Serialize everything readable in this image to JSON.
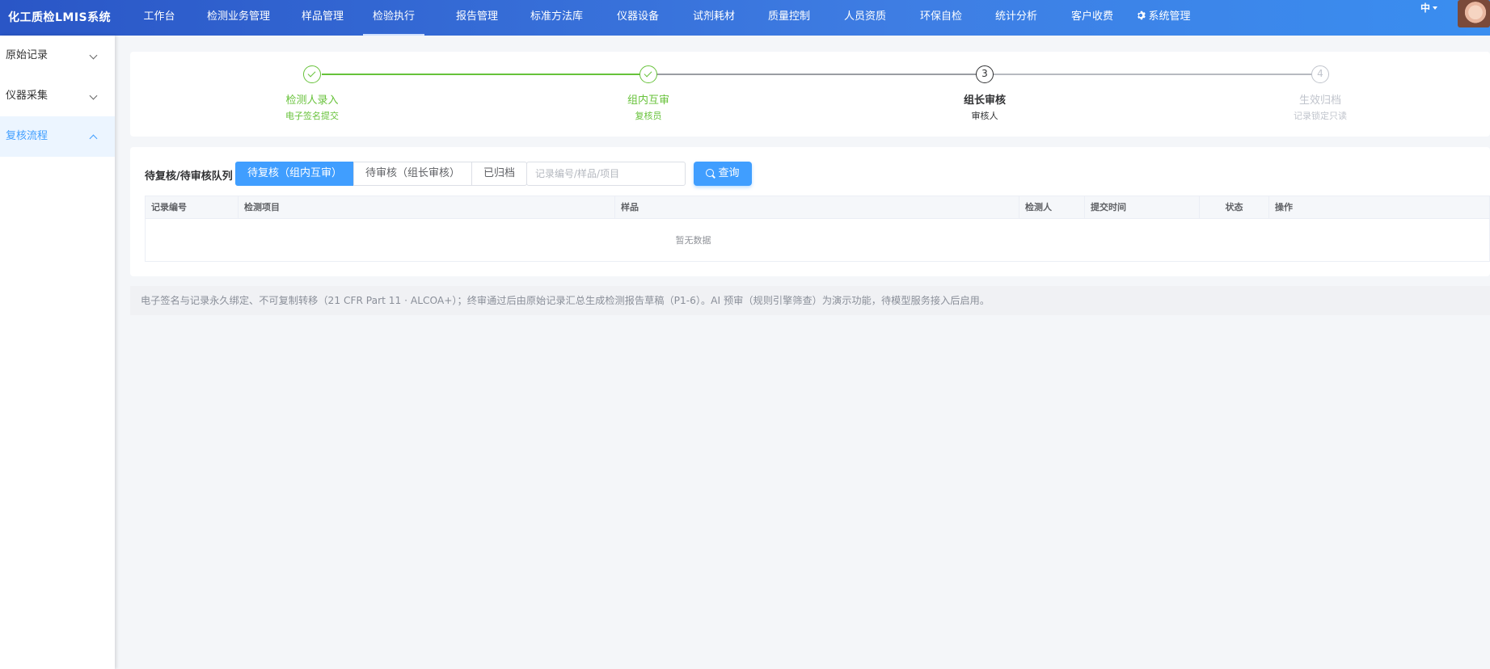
{
  "app": {
    "title": "化工质检LMIS系统"
  },
  "nav": {
    "items": [
      {
        "label": "工作台"
      },
      {
        "label": "检测业务管理"
      },
      {
        "label": "样品管理"
      },
      {
        "label": "检验执行"
      },
      {
        "label": "报告管理"
      },
      {
        "label": "标准方法库"
      },
      {
        "label": "仪器设备"
      },
      {
        "label": "试剂耗材"
      },
      {
        "label": "质量控制"
      },
      {
        "label": "人员资质"
      },
      {
        "label": "环保自检"
      },
      {
        "label": "统计分析"
      },
      {
        "label": "客户收费"
      },
      {
        "label": "系统管理"
      }
    ],
    "active": "检验执行",
    "lang": "中"
  },
  "sidebar": {
    "items": [
      {
        "label": "原始记录",
        "expanded": false
      },
      {
        "label": "仪器采集",
        "expanded": false
      },
      {
        "label": "复核流程",
        "expanded": true,
        "active": true
      }
    ]
  },
  "steps": [
    {
      "number": "1",
      "title": "检测人录入",
      "desc": "电子签名提交",
      "status": "done"
    },
    {
      "number": "2",
      "title": "组内互审",
      "desc": "复核员",
      "status": "done"
    },
    {
      "number": "3",
      "title": "组长审核",
      "desc": "审核人",
      "status": "current"
    },
    {
      "number": "4",
      "title": "生效归档",
      "desc": "记录锁定只读",
      "status": "wait"
    }
  ],
  "queue": {
    "label": "待复核/待审核队列",
    "tabs": [
      {
        "label": "待复核（组内互审）",
        "active": true
      },
      {
        "label": "待审核（组长审核）",
        "active": false
      },
      {
        "label": "已归档",
        "active": false
      }
    ],
    "search": {
      "value": "",
      "placeholder": "记录编号/样品/项目"
    },
    "query_label": "查询",
    "columns": [
      "记录编号",
      "检测项目",
      "样品",
      "检测人",
      "提交时间",
      "状态",
      "操作"
    ],
    "empty_text": "暂无数据"
  },
  "notice": "电子签名与记录永久绑定、不可复制转移（21 CFR Part 11 · ALCOA+）；终审通过后由原始记录汇总生成检测报告草稿（P1-6）。AI 预审（规则引擎筛查）为演示功能，待模型服务接入后启用。",
  "colors": {
    "primary": "#409eff",
    "success": "#67c23a",
    "nav_start": "#2a56c6",
    "nav_end": "#3a8ef0"
  }
}
